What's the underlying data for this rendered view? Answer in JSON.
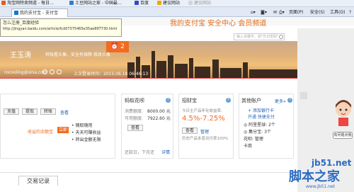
{
  "favorites": [
    {
      "label": "淘宝网特卖频道 - 每日…",
      "color": "#e85a1a"
    },
    {
      "label": "土豆网站之家 - 中国最…",
      "color": "#2e7fcf"
    },
    {
      "label": "百度",
      "color": "#2e49cf"
    },
    {
      "label": "建议网站",
      "color": "#f2a60d"
    },
    {
      "label": "建议网站",
      "color": "#d0d6df"
    }
  ],
  "tab": {
    "label": "我的支付宝 - 支付宝"
  },
  "toolbar": {
    "page": "页面(P)",
    "safety": "安全(S)",
    "tools": "工具(O)",
    "help": "?"
  },
  "tooltip": {
    "line1": "怎么注册_百度经验",
    "line2": "http://jingyan.baidu.com/article/fcd07375465e35ae89T730.html"
  },
  "nav": {
    "text": "我的支付宝    安全中心    会员频道"
  },
  "search": {
    "placeholder": "输入关键字，如\"忘记密码\""
  },
  "banner": {
    "alarm": "2",
    "username": "王玉涛",
    "slogan": "转账看头像，安全有保障 修改头像",
    "account": "rocooling@sina.com",
    "last_login": "上次登录时间：2015.06.18 06:46:13"
  },
  "balance_card": {
    "buttons": [
      "充值",
      "提现",
      "转账"
    ],
    "view": "查看",
    "items": [
      "随取随用",
      "天天可赚收益",
      "转出金额无限"
    ],
    "label": "收益的余额宝",
    "open": "立即"
  },
  "huabei": {
    "title": "蚂蚁花呗",
    "limit_label": "消费额度:",
    "limit": "8000.00 元",
    "avail_label": "可用额度:",
    "avail": "7922.60 元",
    "view": "查看",
    "repay": "还款日，下月还",
    "detail": "详情"
  },
  "zhaocaibao": {
    "title": "招财宝",
    "desc": "今日主产品年化收益率:",
    "rate": "4.5%-7.25%",
    "tag": "保本",
    "view": "查看",
    "manage": "管理",
    "history": "历史产品本息兑付率100%"
  },
  "others": {
    "title": "其他账户",
    "more": "更多»",
    "add_card": "+ 添加银行卡",
    "express": "开通 快捷支付",
    "stars": "阿里星球: 2个",
    "ticket": "集分宝: 3个",
    "huabei": "花呗: 管理",
    "coupon": "卡券"
  },
  "bottom": {
    "tab": "交易记录"
  },
  "helper": {
    "label": "有问题点我"
  },
  "watermark": {
    "site": "jb51.net",
    "name": "脚本之家",
    "small": "www.jb51.net"
  }
}
